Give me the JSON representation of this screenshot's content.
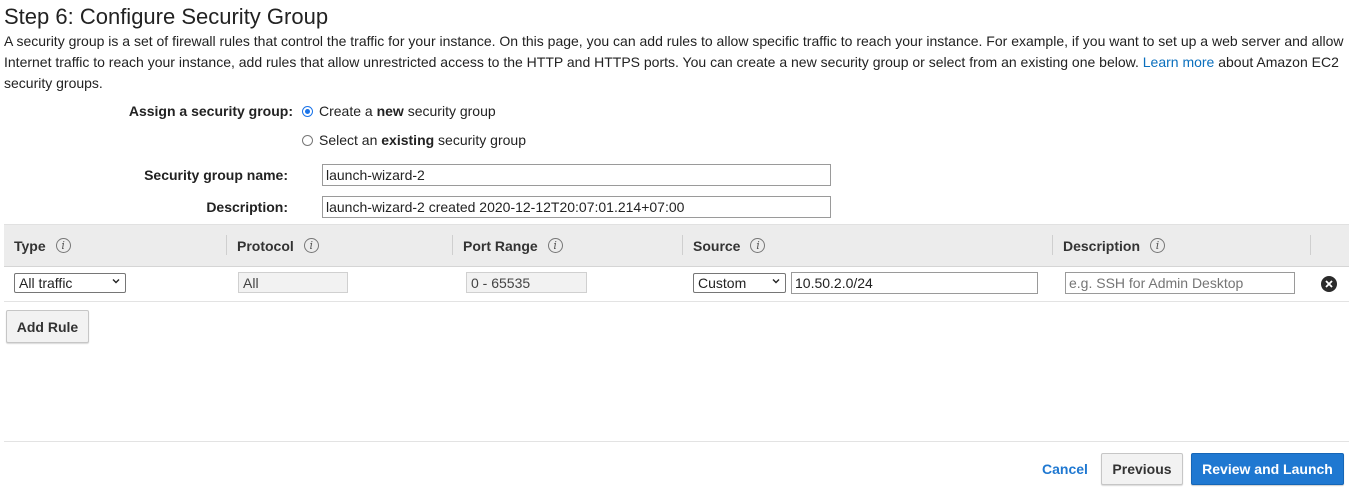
{
  "page": {
    "title": "Step 6: Configure Security Group",
    "intro_text": "A security group is a set of firewall rules that control the traffic for your instance. On this page, you can add rules to allow specific traffic to reach your instance. For example, if you want to set up a web server and allow Internet traffic to reach your instance, add rules that allow unrestricted access to the HTTP and HTTPS ports. You can create a new security group or select from an existing one below. ",
    "intro_link": "Learn more",
    "intro_suffix": " about Amazon EC2 security groups."
  },
  "assign": {
    "label": "Assign a security group:",
    "options": [
      {
        "prefix": "Create a ",
        "bold": "new",
        "suffix": " security group",
        "selected": true
      },
      {
        "prefix": "Select an ",
        "bold": "existing",
        "suffix": " security group",
        "selected": false
      }
    ]
  },
  "form": {
    "name_label": "Security group name:",
    "name_value": "launch-wizard-2",
    "description_label": "Description:",
    "description_value": "launch-wizard-2 created 2020-12-12T20:07:01.214+07:00"
  },
  "table": {
    "headers": [
      "Type",
      "Protocol",
      "Port Range",
      "Source",
      "Description"
    ],
    "rows": [
      {
        "type": "All traffic",
        "protocol": "All",
        "port_range": "0 - 65535",
        "source_type": "Custom",
        "source_value": "10.50.2.0/24",
        "description_placeholder": "e.g. SSH for Admin Desktop"
      }
    ]
  },
  "actions": {
    "add_rule": "Add Rule",
    "cancel": "Cancel",
    "previous": "Previous",
    "review_launch": "Review and Launch"
  },
  "icons": {
    "info": "info-icon",
    "remove": "remove-circle-icon",
    "dropdown": "chevron-down-icon"
  },
  "colors": {
    "link": "#0a6fbd",
    "primary_button": "#1f78d1",
    "radio_selected": "#1a73e8",
    "table_header_bg": "#ececec"
  }
}
